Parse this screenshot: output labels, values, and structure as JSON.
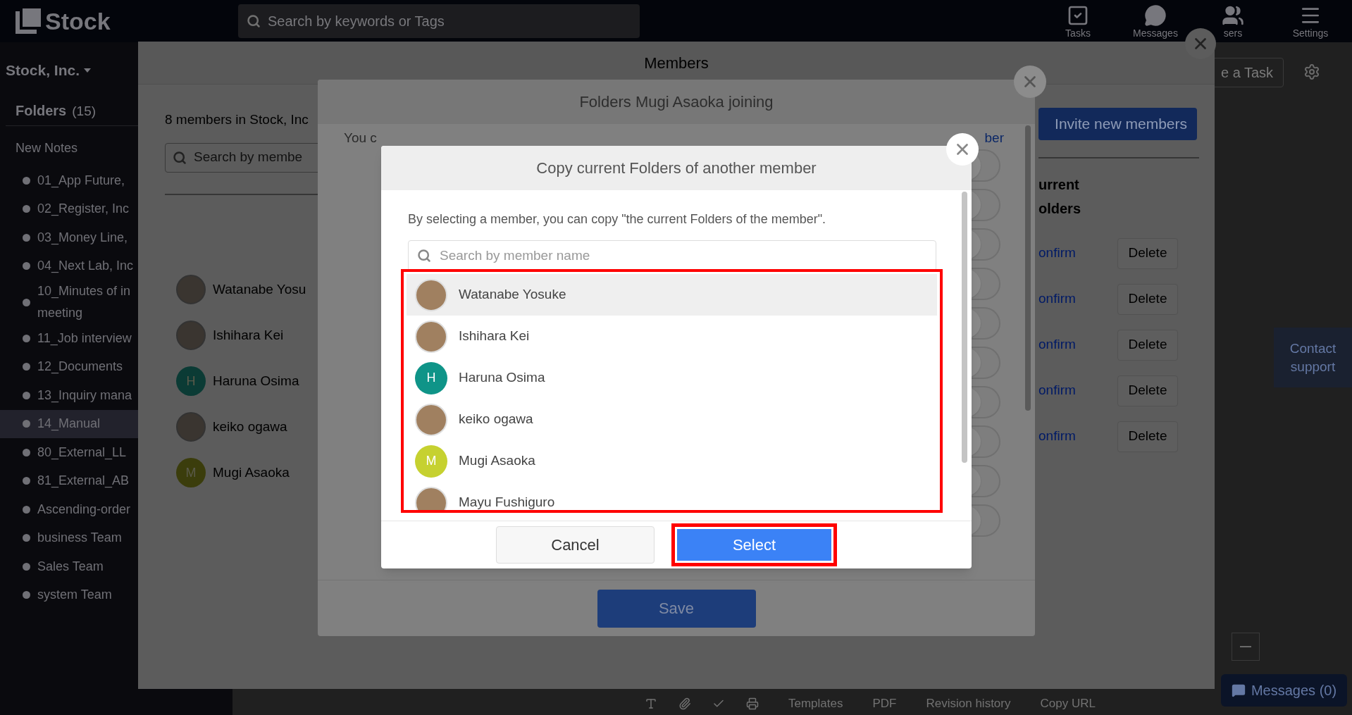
{
  "header": {
    "logo": "Stock",
    "search_placeholder": "Search by keywords or Tags",
    "nav": [
      {
        "label": "Tasks",
        "kind": "tasks"
      },
      {
        "label": "Messages",
        "kind": "messages"
      },
      {
        "label": "sers",
        "kind": "users"
      },
      {
        "label": "Settings",
        "kind": "settings"
      }
    ]
  },
  "sidebar": {
    "workspace": "Stock, Inc.",
    "folders_label": "Folders",
    "folders_count": "(15)",
    "new_notes": "New Notes",
    "items": [
      {
        "label": "01_App Future,",
        "selected": false
      },
      {
        "label": "02_Register, Inc",
        "selected": false
      },
      {
        "label": "03_Money Line,",
        "selected": false
      },
      {
        "label": "04_Next Lab, Inc",
        "selected": false
      },
      {
        "label": "10_Minutes of in\nmeeting",
        "selected": false
      },
      {
        "label": "11_Job interview",
        "selected": false
      },
      {
        "label": "12_Documents",
        "selected": false
      },
      {
        "label": "13_Inquiry mana",
        "selected": false
      },
      {
        "label": "14_Manual",
        "selected": true
      },
      {
        "label": "80_External_LL",
        "selected": false
      },
      {
        "label": "81_External_AB",
        "selected": false
      },
      {
        "label": "Ascending-order",
        "selected": false
      },
      {
        "label": "business Team",
        "selected": false
      },
      {
        "label": "Sales Team",
        "selected": false
      },
      {
        "label": "system Team",
        "selected": false
      }
    ]
  },
  "main": {
    "task_button": "e a Task",
    "contact_support": "Contact support",
    "messages_button": "Messages (0)",
    "toolbar": [
      "Templates",
      "PDF",
      "Revision history",
      "Copy URL"
    ]
  },
  "members_modal": {
    "title": "Members",
    "count_text": "8 members in Stock, Inc",
    "search_placeholder": "Search by membe",
    "invite_button": "Invite new members",
    "column_header": "urrent\nolders",
    "rows": [
      {
        "name": "Watanabe Yosu",
        "kind": "photo",
        "link": "onfirm",
        "action": "Delete"
      },
      {
        "name": "Ishihara Kei",
        "kind": "photo",
        "link": "onfirm",
        "action": "Delete"
      },
      {
        "name": "Haruna Osima",
        "kind": "initial",
        "initial": "H",
        "color": "#0b3b35",
        "link": "onfirm",
        "action": "Delete"
      },
      {
        "name": "keiko ogawa",
        "kind": "photo",
        "link": "onfirm",
        "action": "Delete"
      },
      {
        "name": "Mugi Asaoka",
        "kind": "initial",
        "initial": "M",
        "color": "#3b3d0c",
        "link": "onfirm",
        "action": "Delete"
      }
    ]
  },
  "folders_modal": {
    "title": "Folders Mugi Asaoka joining",
    "text_start": "You c",
    "text_end": "ber",
    "toggles": [
      {
        "on": false
      },
      {
        "on": false
      },
      {
        "on": false
      },
      {
        "on": false
      },
      {
        "on": false
      },
      {
        "on": false
      },
      {
        "on": false
      },
      {
        "on": false
      },
      {
        "on": false
      },
      {
        "on": false
      }
    ],
    "save_button": "Save"
  },
  "copy_dialog": {
    "title": "Copy current Folders of another member",
    "description": "By selecting a member, you can copy \"the current Folders of the member\".",
    "search_placeholder": "Search by member name",
    "members": [
      {
        "name": "Watanabe Yosuke",
        "kind": "photo",
        "selected": true
      },
      {
        "name": "Ishihara Kei",
        "kind": "photo",
        "selected": false
      },
      {
        "name": "Haruna Osima",
        "kind": "initial",
        "initial": "H",
        "color": "#0f9488",
        "selected": false
      },
      {
        "name": "keiko ogawa",
        "kind": "photo",
        "selected": false
      },
      {
        "name": "Mugi Asaoka",
        "kind": "initial",
        "initial": "M",
        "color": "#c6d130",
        "selected": false
      },
      {
        "name": "Mayu Fushiguro",
        "kind": "photo",
        "selected": false
      }
    ],
    "cancel_button": "Cancel",
    "select_button": "Select"
  }
}
